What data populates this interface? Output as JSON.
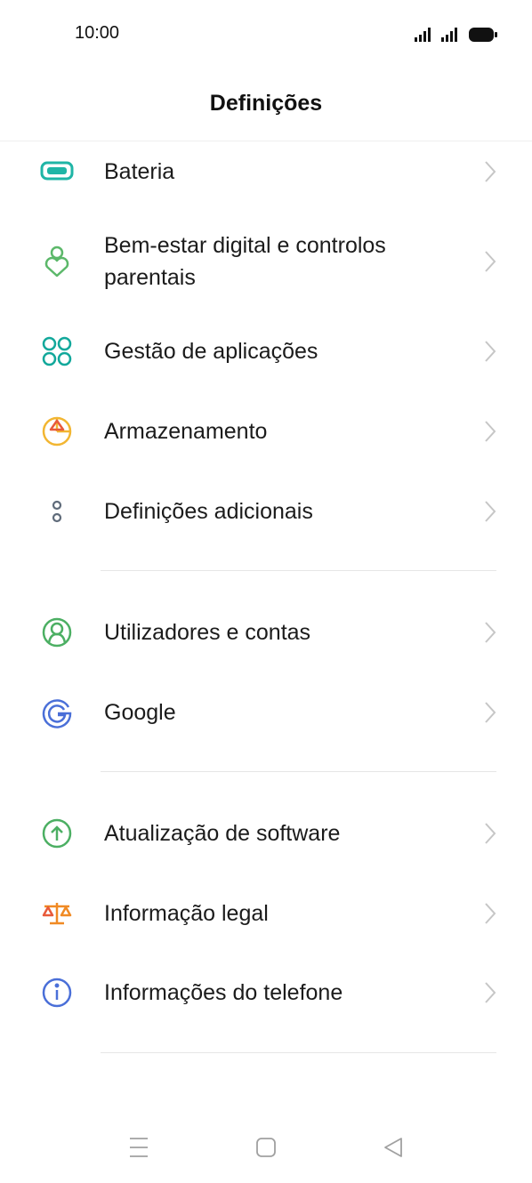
{
  "status_bar": {
    "time": "10:00",
    "icons": [
      "signal-icon",
      "signal-icon",
      "battery-icon"
    ]
  },
  "header": {
    "title": "Definições"
  },
  "groups": [
    {
      "items": [
        {
          "label": "Bateria",
          "icon": "battery-icon",
          "color": "#1fb5a6"
        },
        {
          "label_line1": "Bem-estar digital e controlos",
          "label_line2": "parentais",
          "icon": "digital-wellbeing-icon",
          "color": "#5cb86a"
        },
        {
          "label": "Gestão de aplicações",
          "icon": "apps-icon",
          "color": "#12a89b"
        },
        {
          "label": "Armazenamento",
          "icon": "storage-icon",
          "color": "#f2b632"
        },
        {
          "label": "Definições adicionais",
          "icon": "more-settings-icon",
          "color": "#5f6b7a"
        }
      ]
    },
    {
      "items": [
        {
          "label": "Utilizadores e contas",
          "icon": "users-icon",
          "color": "#4caf63"
        },
        {
          "label": "Google",
          "icon": "google-icon",
          "color": "#4a6fd8"
        }
      ]
    },
    {
      "items": [
        {
          "label": "Atualização de software",
          "icon": "update-icon",
          "color": "#4caf63"
        },
        {
          "label": "Informação legal",
          "icon": "legal-icon",
          "color": "#f08a24"
        },
        {
          "label": "Informações do telefone",
          "icon": "info-icon",
          "color": "#4a6fd8"
        }
      ]
    }
  ],
  "nav_bar": {
    "buttons": [
      "menu-icon",
      "home-icon",
      "back-icon"
    ]
  }
}
